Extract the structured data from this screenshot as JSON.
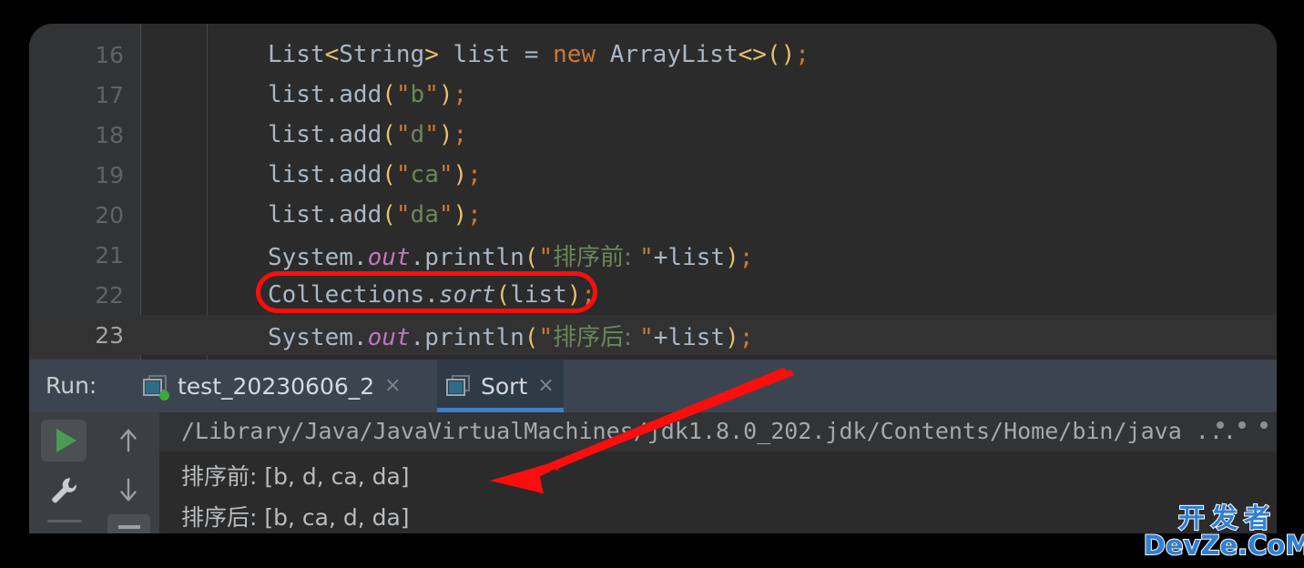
{
  "editor": {
    "lines": [
      {
        "number": "16",
        "indent": 0,
        "current": false,
        "tokens": [
          {
            "t": "List",
            "c": "t-plain"
          },
          {
            "t": "<",
            "c": "t-angle"
          },
          {
            "t": "String",
            "c": "t-plain"
          },
          {
            "t": ">",
            "c": "t-angle"
          },
          {
            "t": " list = ",
            "c": "t-plain"
          },
          {
            "t": "new",
            "c": "t-keyword"
          },
          {
            "t": " ArrayList",
            "c": "t-plain"
          },
          {
            "t": "<>",
            "c": "t-angle"
          },
          {
            "t": "()",
            "c": "t-paren"
          },
          {
            "t": ";",
            "c": "t-semi"
          }
        ]
      },
      {
        "number": "17",
        "indent": 0,
        "current": false,
        "tokens": [
          {
            "t": "list.add",
            "c": "t-plain"
          },
          {
            "t": "(",
            "c": "t-paren"
          },
          {
            "t": "\"",
            "c": "t-quote"
          },
          {
            "t": "b",
            "c": "t-string"
          },
          {
            "t": "\"",
            "c": "t-quote"
          },
          {
            "t": ")",
            "c": "t-paren"
          },
          {
            "t": ";",
            "c": "t-semi"
          }
        ]
      },
      {
        "number": "18",
        "indent": 0,
        "current": false,
        "tokens": [
          {
            "t": "list.add",
            "c": "t-plain"
          },
          {
            "t": "(",
            "c": "t-paren"
          },
          {
            "t": "\"",
            "c": "t-quote"
          },
          {
            "t": "d",
            "c": "t-string"
          },
          {
            "t": "\"",
            "c": "t-quote"
          },
          {
            "t": ")",
            "c": "t-paren"
          },
          {
            "t": ";",
            "c": "t-semi"
          }
        ]
      },
      {
        "number": "19",
        "indent": 0,
        "current": false,
        "tokens": [
          {
            "t": "list.add",
            "c": "t-plain"
          },
          {
            "t": "(",
            "c": "t-paren"
          },
          {
            "t": "\"",
            "c": "t-quote"
          },
          {
            "t": "ca",
            "c": "t-string"
          },
          {
            "t": "\"",
            "c": "t-quote"
          },
          {
            "t": ")",
            "c": "t-paren"
          },
          {
            "t": ";",
            "c": "t-semi"
          }
        ]
      },
      {
        "number": "20",
        "indent": 0,
        "current": false,
        "tokens": [
          {
            "t": "list.add",
            "c": "t-plain"
          },
          {
            "t": "(",
            "c": "t-paren"
          },
          {
            "t": "\"",
            "c": "t-quote"
          },
          {
            "t": "da",
            "c": "t-string"
          },
          {
            "t": "\"",
            "c": "t-quote"
          },
          {
            "t": ")",
            "c": "t-paren"
          },
          {
            "t": ";",
            "c": "t-semi"
          }
        ]
      },
      {
        "number": "21",
        "indent": 0,
        "current": false,
        "tokens": [
          {
            "t": "System.",
            "c": "t-plain"
          },
          {
            "t": "out",
            "c": "t-static"
          },
          {
            "t": ".println",
            "c": "t-plain"
          },
          {
            "t": "(",
            "c": "t-paren"
          },
          {
            "t": "\"",
            "c": "t-quote"
          },
          {
            "t": "排序前: ",
            "c": "t-cjk"
          },
          {
            "t": "\"",
            "c": "t-quote"
          },
          {
            "t": "+list",
            "c": "t-plain"
          },
          {
            "t": ")",
            "c": "t-paren"
          },
          {
            "t": ";",
            "c": "t-semi"
          }
        ]
      },
      {
        "number": "22",
        "indent": 0,
        "current": false,
        "tokens": [
          {
            "t": "Collections.",
            "c": "t-plain"
          },
          {
            "t": "sort",
            "c": "t-italic"
          },
          {
            "t": "(",
            "c": "t-paren"
          },
          {
            "t": "list",
            "c": "t-plain"
          },
          {
            "t": ")",
            "c": "t-paren"
          },
          {
            "t": ";",
            "c": "t-semi"
          }
        ]
      },
      {
        "number": "23",
        "indent": 0,
        "current": true,
        "tokens": [
          {
            "t": "System.",
            "c": "t-plain"
          },
          {
            "t": "out",
            "c": "t-static"
          },
          {
            "t": ".println",
            "c": "t-plain"
          },
          {
            "t": "(",
            "c": "t-paren"
          },
          {
            "t": "\"",
            "c": "t-quote"
          },
          {
            "t": "排序后: ",
            "c": "t-cjk"
          },
          {
            "t": "\"",
            "c": "t-quote"
          },
          {
            "t": "+list",
            "c": "t-plain"
          },
          {
            "t": ")",
            "c": "t-paren"
          },
          {
            "t": ";",
            "c": "t-semi"
          }
        ]
      }
    ]
  },
  "run_panel": {
    "label": "Run:",
    "tabs": [
      {
        "title": "test_20230606_2",
        "close": "×",
        "active": false,
        "running": true
      },
      {
        "title": "Sort",
        "close": "×",
        "active": true,
        "running": false
      }
    ],
    "toolbar": {
      "rerun": "rerun-button",
      "settings": "wrench-button",
      "up": "↑",
      "down": "↓",
      "minimize": "minimize-button"
    },
    "console": {
      "command_line": "/Library/Java/JavaVirtualMachines/jdk1.8.0_202.jdk/Contents/Home/bin/java ...",
      "output_lines": [
        "排序前: [b, d, ca, da]",
        "排序后: [b, ca, d, da]"
      ]
    }
  },
  "annotations": {
    "ellipse_target": "Collections.sort(list);",
    "arrow_color": "#fd0d0d",
    "ellipse_color": "#fd0d0d"
  },
  "watermark": {
    "cn": "开发者",
    "en": "DevZe.CoM"
  },
  "colors": {
    "editor_bg": "#2b2b2b",
    "gutter_bg": "#313335",
    "tabbar_bg": "#3c4450",
    "accent_blue": "#3e7ec4",
    "run_green": "#499c54",
    "annotation_red": "#fd0d0d",
    "keyword_orange": "#cc7832",
    "string_green": "#6a8759",
    "paren_yellow": "#e8bf6a",
    "static_purple": "#c077bd",
    "text_gray": "#a9b7c6"
  }
}
